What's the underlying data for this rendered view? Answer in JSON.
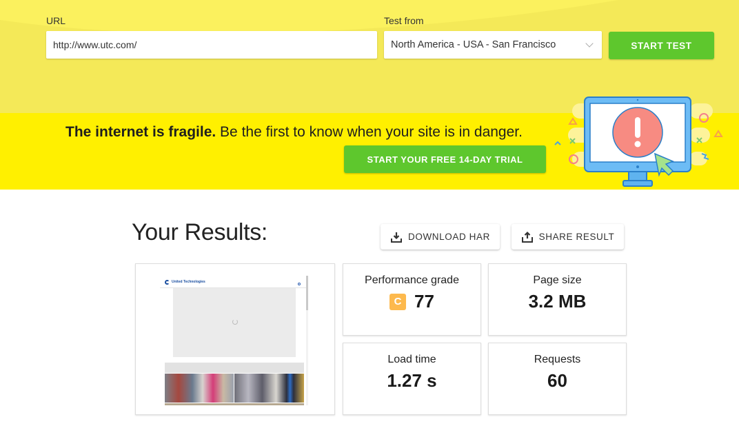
{
  "form": {
    "url_label": "URL",
    "url_value": "http://www.utc.com/",
    "test_from_label": "Test from",
    "test_from_selected": "North America - USA - San Francisco",
    "start_button": "START TEST"
  },
  "banner": {
    "headline_bold": "The internet is fragile.",
    "headline_rest": " Be the first to know when your site is in danger.",
    "trial_button": "START YOUR FREE 14-DAY TRIAL",
    "illustration": "monitor-alert-icon"
  },
  "results": {
    "title": "Your Results:",
    "download_button": "DOWNLOAD HAR",
    "share_button": "SHARE RESULT",
    "screenshot_site_name": "United Technologies",
    "metrics": [
      {
        "label": "Performance grade",
        "grade": "C",
        "value": "77",
        "grade_color": "#fdb94d"
      },
      {
        "label": "Page size",
        "value": "3.2 MB"
      },
      {
        "label": "Load time",
        "value": "1.27 s"
      },
      {
        "label": "Requests",
        "value": "60"
      }
    ]
  },
  "colors": {
    "top_bg": "#f4e958",
    "banner_bg": "#fff000",
    "accent_green": "#5ec72d"
  }
}
